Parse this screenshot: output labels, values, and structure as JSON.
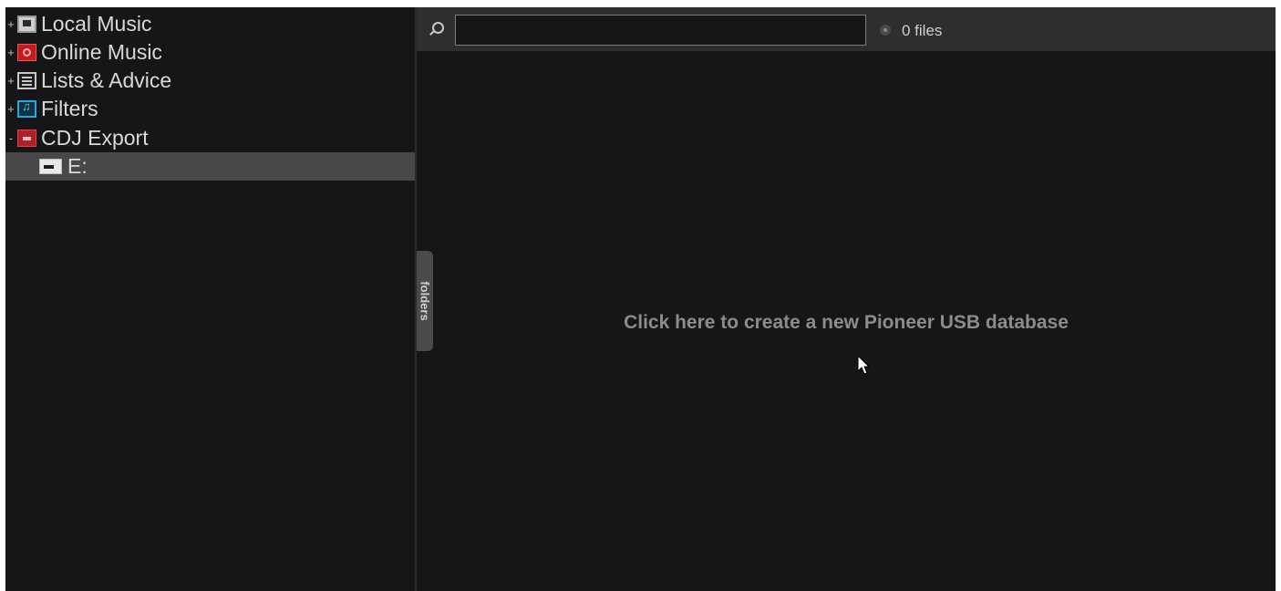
{
  "sidebar": {
    "items": [
      {
        "expander": "+",
        "label": "Local Music",
        "icon": "computer-icon"
      },
      {
        "expander": "+",
        "label": "Online Music",
        "icon": "online-music-icon"
      },
      {
        "expander": "+",
        "label": "Lists & Advice",
        "icon": "list-icon"
      },
      {
        "expander": "+",
        "label": "Filters",
        "icon": "filter-icon"
      },
      {
        "expander": "-",
        "label": "CDJ Export",
        "icon": "cdj-export-icon"
      },
      {
        "label": "E:",
        "icon": "usb-drive-icon",
        "selected": true
      }
    ]
  },
  "toolbar": {
    "search_value": "",
    "file_count": "0 files"
  },
  "folders_tab": {
    "label": "folders"
  },
  "main": {
    "create_db_label": "Click here to create a new Pioneer USB database"
  },
  "colors": {
    "background": "#161618",
    "toolbar": "#2e2e30",
    "selected": "#48484a",
    "accent_red": "#c41c1c",
    "accent_blue": "#2aa6d8"
  }
}
